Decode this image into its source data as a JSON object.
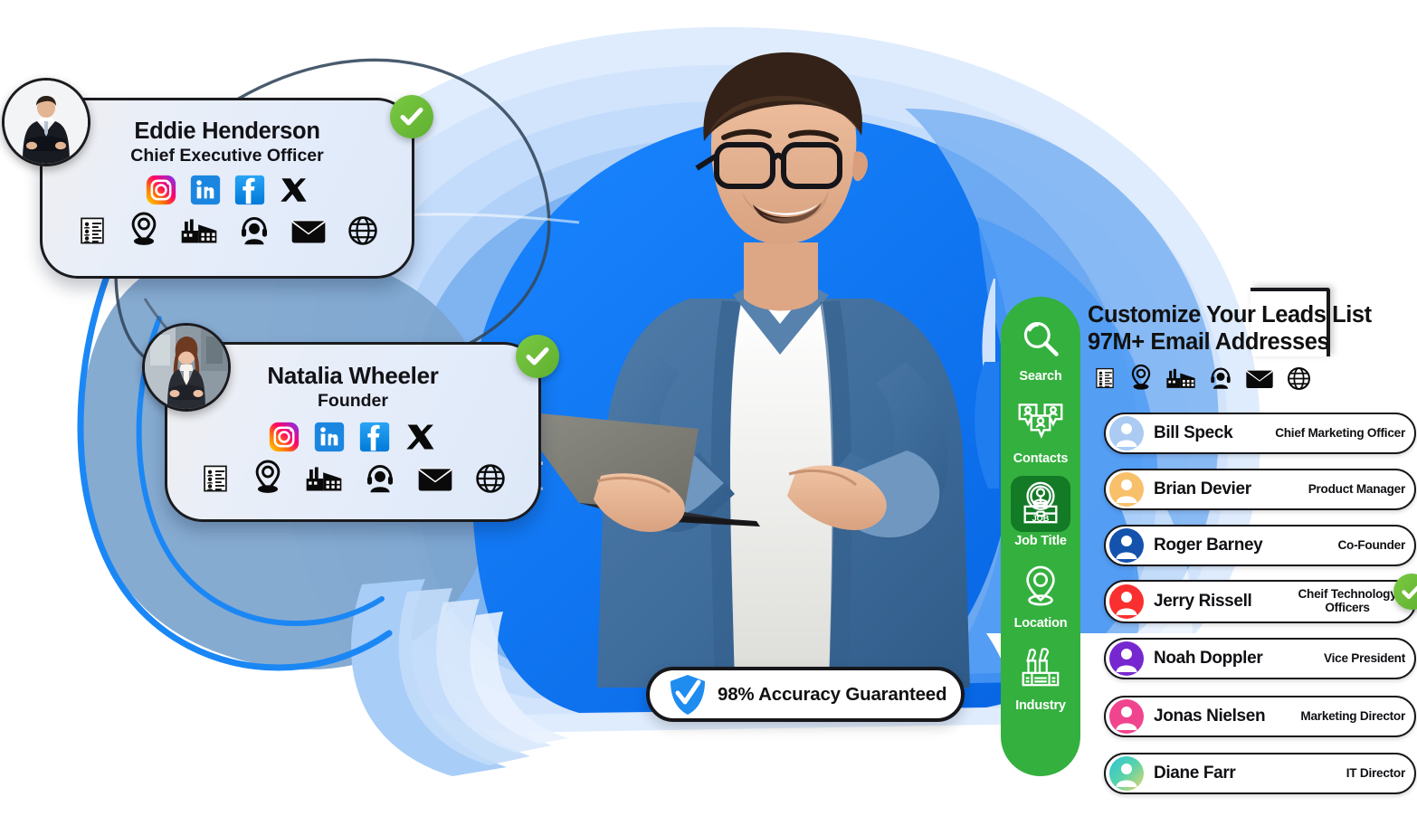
{
  "accent": {
    "blue": "#0b76ef",
    "blue_deep": "#0a63d6",
    "blue_pale": "#cfe2fb",
    "green": "#34b03e",
    "green_dark": "#137a26",
    "check_green": "#6fbf3b",
    "shield_blue": "#1f8cf0",
    "ink": "#111115"
  },
  "profile_cards": [
    {
      "name": "Eddie Henderson",
      "title": "Chief Executive Officer",
      "verified": true,
      "social": [
        "instagram-icon",
        "linkedin-icon",
        "facebook-icon",
        "x-twitter-icon"
      ],
      "attributes": [
        "contact-list-icon",
        "location-pin-icon",
        "industry-factory-icon",
        "support-agent-icon",
        "email-envelope-icon",
        "globe-website-icon"
      ]
    },
    {
      "name": "Natalia Wheeler",
      "title": "Founder",
      "verified": true,
      "social": [
        "instagram-icon",
        "linkedin-icon",
        "facebook-icon",
        "x-twitter-icon"
      ],
      "attributes": [
        "contact-list-icon",
        "location-pin-icon",
        "industry-factory-icon",
        "support-agent-icon",
        "email-envelope-icon",
        "globe-website-icon"
      ]
    }
  ],
  "accuracy_badge": {
    "label": "98% Accuracy Guaranteed",
    "icon": "shield-check-icon"
  },
  "filter_rail": {
    "items": [
      {
        "label": "Search",
        "icon": "magnifier-icon",
        "active": false
      },
      {
        "label": "Contacts",
        "icon": "contacts-group-icon",
        "active": false
      },
      {
        "label": "Job Title",
        "icon": "job-badge-icon",
        "active": true
      },
      {
        "label": "Location",
        "icon": "location-pin-icon",
        "active": false
      },
      {
        "label": "Industry",
        "icon": "factory-icon",
        "active": false
      }
    ]
  },
  "leads_panel": {
    "heading_line1": "Customize Your Leads List",
    "heading_line2": "97M+ Email Addresses",
    "attribute_icons": [
      "contact-list-icon",
      "location-pin-icon",
      "industry-factory-icon",
      "support-agent-icon",
      "email-envelope-icon",
      "globe-website-icon"
    ],
    "rows": [
      {
        "name": "Bill Speck",
        "title": "Chief Marketing Officer",
        "avatar_color": "#abcbf2",
        "two_line": false,
        "checked": false
      },
      {
        "name": "Brian Devier",
        "title": "Product Manager",
        "avatar_color": "#f8c06a",
        "two_line": false,
        "checked": false
      },
      {
        "name": "Roger Barney",
        "title": "Co-Founder",
        "avatar_color": "#1552ae",
        "two_line": false,
        "checked": false
      },
      {
        "name": "Jerry Rissell",
        "title": "Cheif Technology Officers",
        "avatar_color": "#fa2f2f",
        "two_line": true,
        "checked": true
      },
      {
        "name": "Noah Doppler",
        "title": "Vice President",
        "avatar_color": "#7727cf",
        "two_line": false,
        "checked": false
      },
      {
        "name": "Jonas Nielsen",
        "title": "Marketing Director",
        "avatar_color": "#f0448f",
        "two_line": false,
        "checked": false
      },
      {
        "name": "Diane Farr",
        "title": "IT Director",
        "avatar_color": "#2fc4d8",
        "two_line": false,
        "checked": false
      }
    ]
  }
}
